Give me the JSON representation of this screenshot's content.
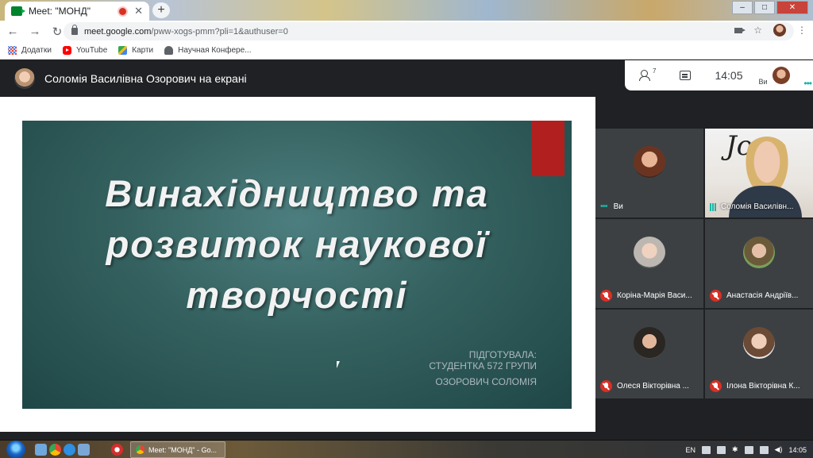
{
  "browser": {
    "tab_title": "Meet: \"МОНД\"",
    "tab_close": "✕",
    "new_tab": "+",
    "url_host": "meet.google.com",
    "url_path": "/pww-xogs-pmm?pli=1&authuser=0",
    "bookmarks": [
      {
        "label": "Додатки"
      },
      {
        "label": "YouTube"
      },
      {
        "label": "Карти"
      },
      {
        "label": "Научная Конфере..."
      }
    ]
  },
  "meet": {
    "presenter_title": "Соломія Василівна Озорович на екрані",
    "participant_count": "7",
    "time": "14:05",
    "self_label": "Ви"
  },
  "slide": {
    "title_line1": "Винахідництво та",
    "title_line2": "розвиток наукової",
    "title_line3": "творчості",
    "prepared_line1": "ПІДГОТУВАЛА:",
    "prepared_line2": "СТУДЕНТКА 572 ГРУПИ",
    "author": "ОЗОРОВИЧ СОЛОМІЯ"
  },
  "participants": [
    {
      "name": "Ви",
      "state": "dots"
    },
    {
      "name": "Соломія Василівн...",
      "state": "speaking",
      "video": "Jo"
    },
    {
      "name": "Коріна-Марія Васи...",
      "state": "muted"
    },
    {
      "name": "Анастасія Андріїв...",
      "state": "muted"
    },
    {
      "name": "Олеся Вікторівна ...",
      "state": "muted"
    },
    {
      "name": "Ілона Вікторівна К...",
      "state": "muted"
    }
  ],
  "taskbar": {
    "task_label": "Meet: \"МОНД\" - Go...",
    "lang": "EN",
    "time": "14:05"
  }
}
